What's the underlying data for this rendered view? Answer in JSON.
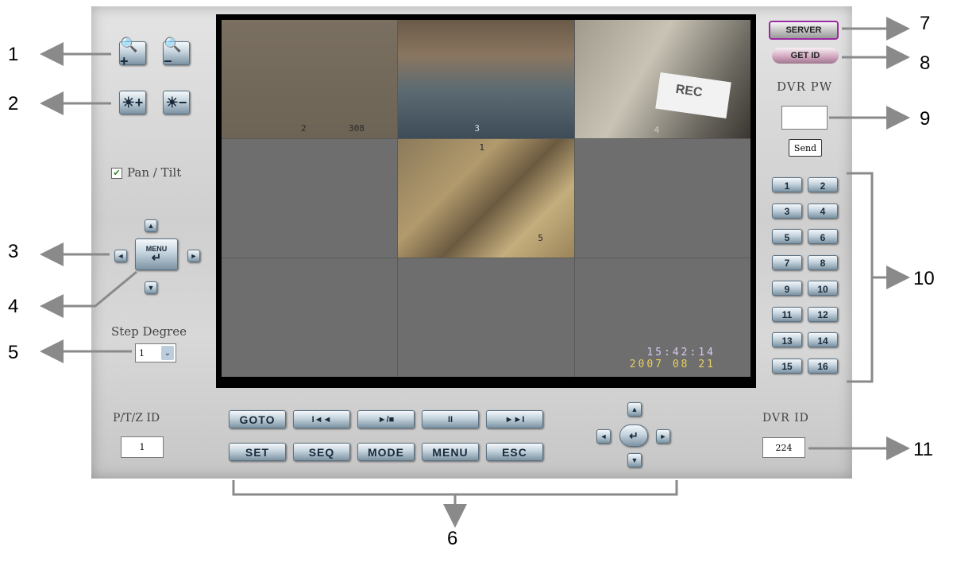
{
  "zoom": {
    "in_icon": "zoom-in-icon",
    "out_icon": "zoom-out-icon"
  },
  "brightness": {
    "up_icon": "brightness-up-icon",
    "down_icon": "brightness-down-icon"
  },
  "pan_tilt": {
    "label": "Pan / Tilt",
    "checked": true
  },
  "dpad": {
    "center_label": "MENU"
  },
  "step_degree": {
    "label": "Step Degree",
    "selected": "1"
  },
  "server_button": "SERVER",
  "get_id_button": "GET ID",
  "dvr_pw": {
    "label": "DVR PW",
    "value": "",
    "send_label": "Send"
  },
  "channels": [
    "1",
    "2",
    "3",
    "4",
    "5",
    "6",
    "7",
    "8",
    "9",
    "10",
    "11",
    "12",
    "13",
    "14",
    "15",
    "16"
  ],
  "bottom_row1": [
    "GOTO",
    "I◄◄",
    "►/■",
    "II",
    "►►I"
  ],
  "bottom_row2": [
    "SET",
    "SEQ",
    "MODE",
    "MENU",
    "ESC"
  ],
  "ptz_id": {
    "label": "P/T/Z ID",
    "value": "1"
  },
  "dvr_id": {
    "label": "DVR ID",
    "value": "224"
  },
  "video": {
    "cell1_label": "2",
    "cell1_label2": "308",
    "cell2_label": "3",
    "cell3_label": "4",
    "rec_text": "REC",
    "cell5_label": "1",
    "cell5_label2": "5",
    "osd_time": "15:42:14",
    "osd_date": "2007 08 21"
  },
  "callouts": [
    "1",
    "2",
    "3",
    "4",
    "5",
    "6",
    "7",
    "8",
    "9",
    "10",
    "11"
  ]
}
